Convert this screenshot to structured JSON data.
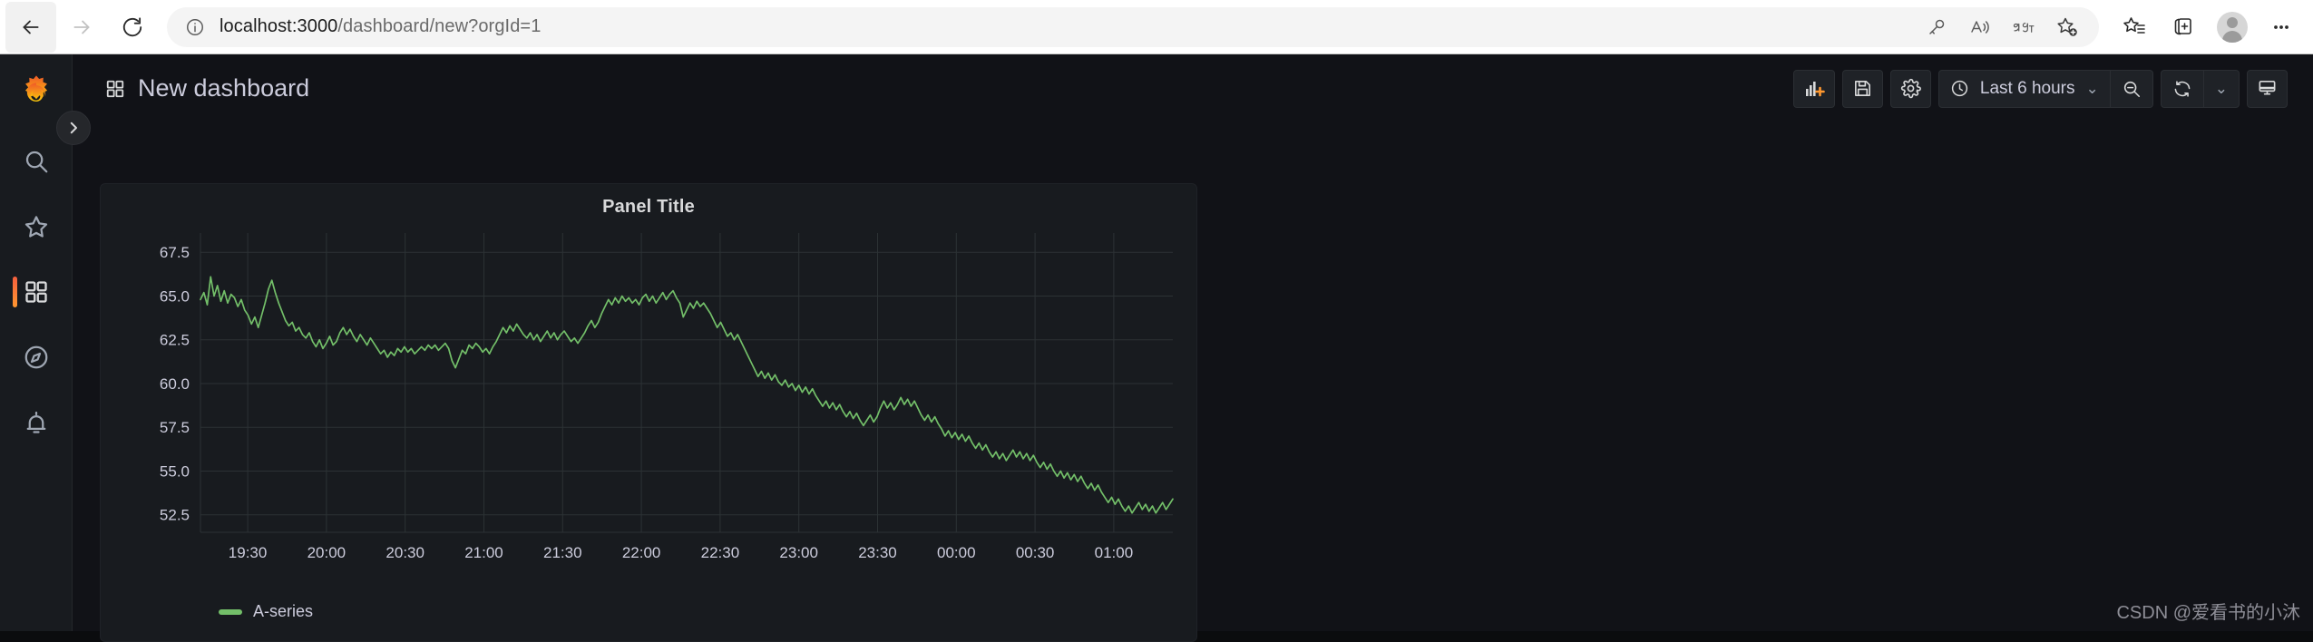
{
  "browser": {
    "back_label": "Back",
    "forward_label": "Forward",
    "reload_label": "Refresh",
    "url_host": "localhost:3000",
    "url_path": "/dashboard/new?orgId=1",
    "info_icon": "info-circle-icon",
    "address_actions": [
      {
        "name": "password-key-icon",
        "label": "Saved passwords"
      },
      {
        "name": "read-aloud-icon",
        "label": "Read aloud"
      },
      {
        "name": "translate-icon",
        "label": "Translate"
      },
      {
        "name": "add-favorite-icon",
        "label": "Add this page to favorites"
      }
    ],
    "toolbar_actions": [
      {
        "name": "favorites-list-icon",
        "label": "Favorites"
      },
      {
        "name": "collections-icon",
        "label": "Collections"
      },
      {
        "name": "profile-avatar",
        "label": "Profile"
      },
      {
        "name": "more-options-icon",
        "label": "Settings and more"
      }
    ]
  },
  "sidebar": {
    "logo_name": "grafana-logo",
    "expand_label": "Expand navigation",
    "items": [
      {
        "name": "sidebar-item-search",
        "label": "Search",
        "icon": "search-icon",
        "active": false
      },
      {
        "name": "sidebar-item-starred",
        "label": "Starred",
        "icon": "star-icon",
        "active": false
      },
      {
        "name": "sidebar-item-dashboards",
        "label": "Dashboards",
        "icon": "apps-grid-icon",
        "active": true
      },
      {
        "name": "sidebar-item-explore",
        "label": "Explore",
        "icon": "compass-icon",
        "active": false
      },
      {
        "name": "sidebar-item-alerting",
        "label": "Alerting",
        "icon": "bell-icon",
        "active": false
      }
    ]
  },
  "topnav": {
    "title": "New dashboard",
    "title_icon": "dashboard-grid-icon",
    "actions": {
      "add_panel_label": "Add panel",
      "save_label": "Save dashboard",
      "settings_label": "Dashboard settings",
      "time_range": "Last 6 hours",
      "time_range_caret": "⌄",
      "zoom_out_label": "Zoom out time range",
      "refresh_label": "Refresh dashboard",
      "refresh_interval_caret": "⌄",
      "kiosk_label": "Cycle view mode"
    }
  },
  "panel": {
    "title": "Panel Title"
  },
  "watermark": "CSDN @爱看书的小沐",
  "colors": {
    "accent_orange": "#ff9830",
    "series_green": "#73bf69",
    "panel_bg": "#181b1f",
    "page_bg": "#111217",
    "grid": "#2c3235",
    "text": "#ccccdc"
  },
  "chart_data": {
    "type": "line",
    "title": "Panel Title",
    "xlabel": "",
    "ylabel": "",
    "grid": true,
    "legend_position": "bottom-left",
    "ylim": [
      51.5,
      68.6
    ],
    "yticks": [
      67.5,
      65.0,
      62.5,
      60.0,
      57.5,
      55.0,
      52.5
    ],
    "xticks": [
      "19:30",
      "20:00",
      "20:30",
      "21:00",
      "21:30",
      "22:00",
      "22:30",
      "23:00",
      "23:30",
      "00:00",
      "00:30",
      "01:00"
    ],
    "series": [
      {
        "name": "A-series",
        "color": "#73bf69",
        "values": [
          64.8,
          65.2,
          64.5,
          66.1,
          65.0,
          65.6,
          64.7,
          65.3,
          64.6,
          65.1,
          64.9,
          64.4,
          64.8,
          64.2,
          63.9,
          63.4,
          63.8,
          63.2,
          63.9,
          64.6,
          65.4,
          65.9,
          65.2,
          64.6,
          64.1,
          63.6,
          63.3,
          63.5,
          63.0,
          63.2,
          62.8,
          62.6,
          62.9,
          62.4,
          62.1,
          62.5,
          62.0,
          62.3,
          62.7,
          62.2,
          62.4,
          62.9,
          63.2,
          62.8,
          63.1,
          62.7,
          62.4,
          62.8,
          62.5,
          62.2,
          62.6,
          62.3,
          62.0,
          61.7,
          61.9,
          61.5,
          61.8,
          61.6,
          62.0,
          61.8,
          62.1,
          61.8,
          62.0,
          61.7,
          61.9,
          62.1,
          61.9,
          62.2,
          62.0,
          62.2,
          61.9,
          62.1,
          62.3,
          62.0,
          61.3,
          60.9,
          61.4,
          61.9,
          61.7,
          62.2,
          62.0,
          62.3,
          62.1,
          61.8,
          62.0,
          61.7,
          62.1,
          62.4,
          62.8,
          63.2,
          62.9,
          63.3,
          63.0,
          63.4,
          63.1,
          62.8,
          62.6,
          62.9,
          62.5,
          62.8,
          62.4,
          62.7,
          63.0,
          62.6,
          62.9,
          62.5,
          62.8,
          63.0,
          62.7,
          62.4,
          62.6,
          62.3,
          62.6,
          62.9,
          63.3,
          63.6,
          63.2,
          63.5,
          64.0,
          64.4,
          64.8,
          64.5,
          64.9,
          64.6,
          65.0,
          64.7,
          64.9,
          64.6,
          64.8,
          64.5,
          64.9,
          65.1,
          64.7,
          65.0,
          64.6,
          64.9,
          65.2,
          64.8,
          65.1,
          65.3,
          64.9,
          64.6,
          63.8,
          64.2,
          64.6,
          64.3,
          64.7,
          64.4,
          64.6,
          64.3,
          64.0,
          63.6,
          63.2,
          63.5,
          63.1,
          62.7,
          62.9,
          62.5,
          62.8,
          62.4,
          62.0,
          61.6,
          61.2,
          60.8,
          60.4,
          60.7,
          60.3,
          60.6,
          60.2,
          60.5,
          60.1,
          59.9,
          60.2,
          59.8,
          60.0,
          59.6,
          59.9,
          59.5,
          59.8,
          59.4,
          59.7,
          59.3,
          59.0,
          58.7,
          59.0,
          58.6,
          58.9,
          58.5,
          58.8,
          58.4,
          58.1,
          58.4,
          58.0,
          58.3,
          57.9,
          57.6,
          57.9,
          58.2,
          57.8,
          58.1,
          58.6,
          59.0,
          58.6,
          58.9,
          58.5,
          58.8,
          59.2,
          58.8,
          59.1,
          58.7,
          59.0,
          58.6,
          58.2,
          57.9,
          58.2,
          57.8,
          58.1,
          57.7,
          57.4,
          57.0,
          57.3,
          56.9,
          57.2,
          56.8,
          57.1,
          56.7,
          57.0,
          56.6,
          56.3,
          56.6,
          56.2,
          56.5,
          56.1,
          55.8,
          56.1,
          55.7,
          56.0,
          55.6,
          55.9,
          56.2,
          55.8,
          56.1,
          55.7,
          56.0,
          55.6,
          55.9,
          55.5,
          55.2,
          55.5,
          55.1,
          55.4,
          55.0,
          54.7,
          55.0,
          54.6,
          54.9,
          54.5,
          54.8,
          54.4,
          54.7,
          54.3,
          54.0,
          54.3,
          53.9,
          54.2,
          53.8,
          53.5,
          53.2,
          53.5,
          53.1,
          53.4,
          53.0,
          52.7,
          53.0,
          52.6,
          52.9,
          53.2,
          52.8,
          53.1,
          52.7,
          53.0,
          52.6,
          52.9,
          53.2,
          52.8,
          53.1,
          53.4
        ]
      }
    ]
  }
}
